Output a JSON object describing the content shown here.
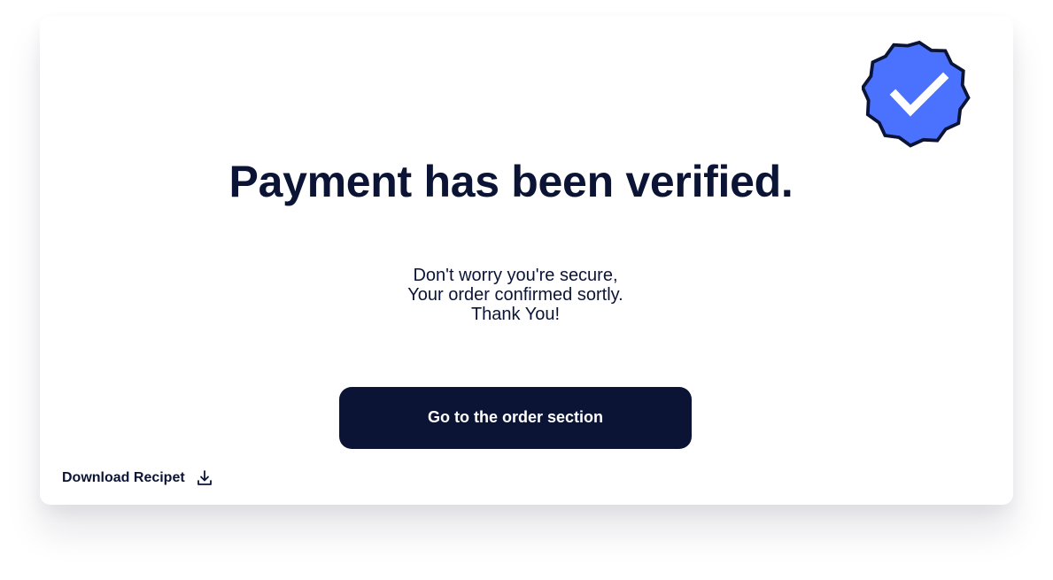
{
  "page": {
    "title": "Payment has been verified.",
    "message_lines": [
      "Don't worry you're secure,",
      "Your order confirmed sortly.",
      "Thank You!"
    ],
    "primary_button_label": "Go to the order section",
    "download_label": "Download Recipet"
  },
  "icons": {
    "badge": "verified-badge-icon",
    "download": "download-icon"
  },
  "colors": {
    "primary": "#0c1435",
    "badge_fill": "#4a72ff",
    "background": "#ffffff"
  }
}
